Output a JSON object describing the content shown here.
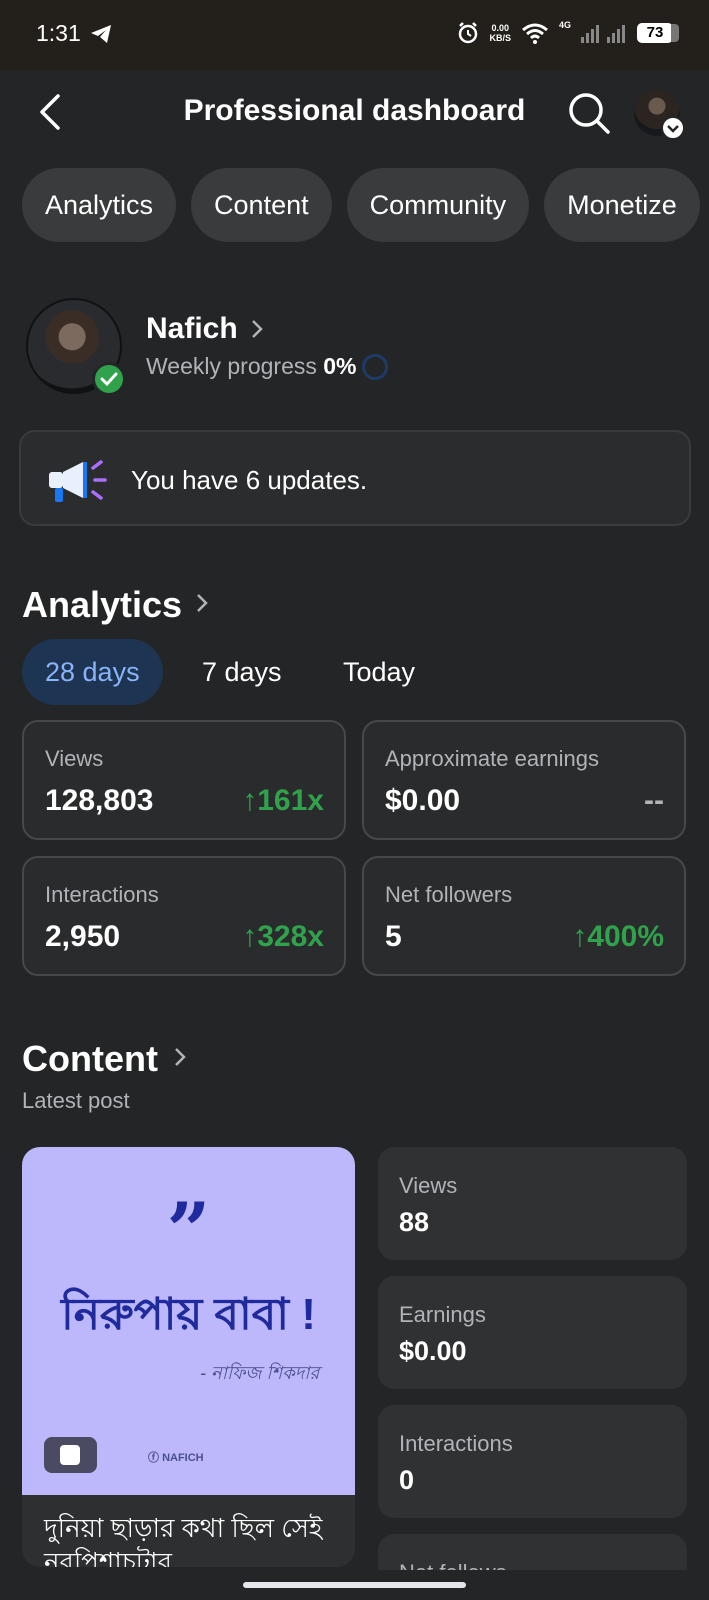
{
  "status_bar": {
    "time": "1:31",
    "net_speed_value": "0.00",
    "net_speed_unit": "KB/S",
    "network": "4G",
    "battery": "73"
  },
  "header": {
    "title": "Professional dashboard"
  },
  "tabs": [
    {
      "label": "Analytics"
    },
    {
      "label": "Content"
    },
    {
      "label": "Community"
    },
    {
      "label": "Monetize"
    }
  ],
  "profile": {
    "name": "Nafich",
    "weekly_progress_label": "Weekly progress",
    "weekly_progress_value": "0%"
  },
  "updates": {
    "text": "You have 6 updates."
  },
  "analytics": {
    "title": "Analytics",
    "periods": [
      {
        "label": "28 days",
        "active": true
      },
      {
        "label": "7 days",
        "active": false
      },
      {
        "label": "Today",
        "active": false
      }
    ],
    "metrics": [
      {
        "label": "Views",
        "value": "128,803",
        "change": "161x"
      },
      {
        "label": "Approximate earnings",
        "value": "$0.00",
        "change": "--"
      },
      {
        "label": "Interactions",
        "value": "2,950",
        "change": "328x"
      },
      {
        "label": "Net followers",
        "value": "5",
        "change": "400%"
      }
    ]
  },
  "content": {
    "title": "Content",
    "latest_label": "Latest post",
    "post": {
      "headline": "নিরুপায় বাবা !",
      "signature": "- নাফিজ শিকদার",
      "brand": "NAFICH",
      "caption": "দুনিয়া ছাড়ার কথা ছিল সেই নরপিশাচটার"
    },
    "stats": [
      {
        "label": "Views",
        "value": "88"
      },
      {
        "label": "Earnings",
        "value": "$0.00"
      },
      {
        "label": "Interactions",
        "value": "0"
      },
      {
        "label": "Net follows",
        "value": ""
      }
    ]
  },
  "colors": {
    "background": "#242526",
    "card": "#2a2b2c",
    "positive": "#31a24c",
    "accent_blue": "#8ab4f8",
    "post_bg": "#bcb8fb",
    "post_text": "#1f2a9c"
  }
}
